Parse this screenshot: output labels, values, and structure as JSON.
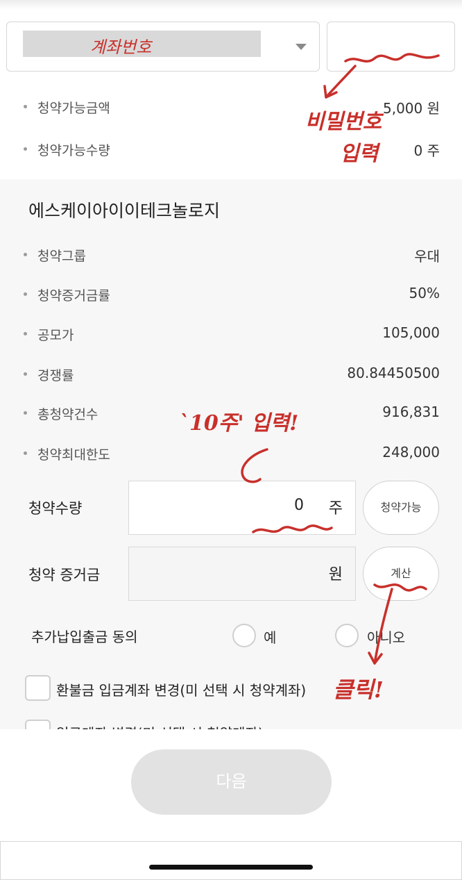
{
  "account": {
    "label": "계좌번호",
    "mask_color": "#d9d9d9"
  },
  "password": {
    "placeholder": ""
  },
  "summary": [
    {
      "label": "청약가능금액",
      "value": "5,000 원"
    },
    {
      "label": "청약가능수량",
      "value": "0 주"
    }
  ],
  "company": "에스케이아이이테크놀로지",
  "details": [
    {
      "label": "청약그룹",
      "value": "우대"
    },
    {
      "label": "청약증거금률",
      "value": "50%"
    },
    {
      "label": "공모가",
      "value": "105,000"
    },
    {
      "label": "경쟁률",
      "value": "80.84450500"
    },
    {
      "label": "총청약건수",
      "value": "916,831"
    },
    {
      "label": "청약최대한도",
      "value": "248,000"
    }
  ],
  "form": {
    "qty_label": "청약수량",
    "qty_value": "0",
    "qty_unit": "주",
    "qty_button": "청약가능",
    "deposit_label": "청약 증거금",
    "deposit_value": "",
    "deposit_unit": "원",
    "calc_button": "계산",
    "consent_label": "추가납입출금 동의",
    "yes": "예",
    "no": "아니오",
    "refund_checkbox": "환불금 입금계좌 변경(미 선택 시 청약계좌)",
    "deposit_checkbox": "입금계좌 변경(미 선택 시 청약계좌)"
  },
  "next_button": "다음",
  "annotations": {
    "pw_note_line1": "비밀번호",
    "pw_note_line2": "입력",
    "qty_note": "`10주' 입력!",
    "click_note": "클릭!",
    "color": "#c8302b"
  }
}
